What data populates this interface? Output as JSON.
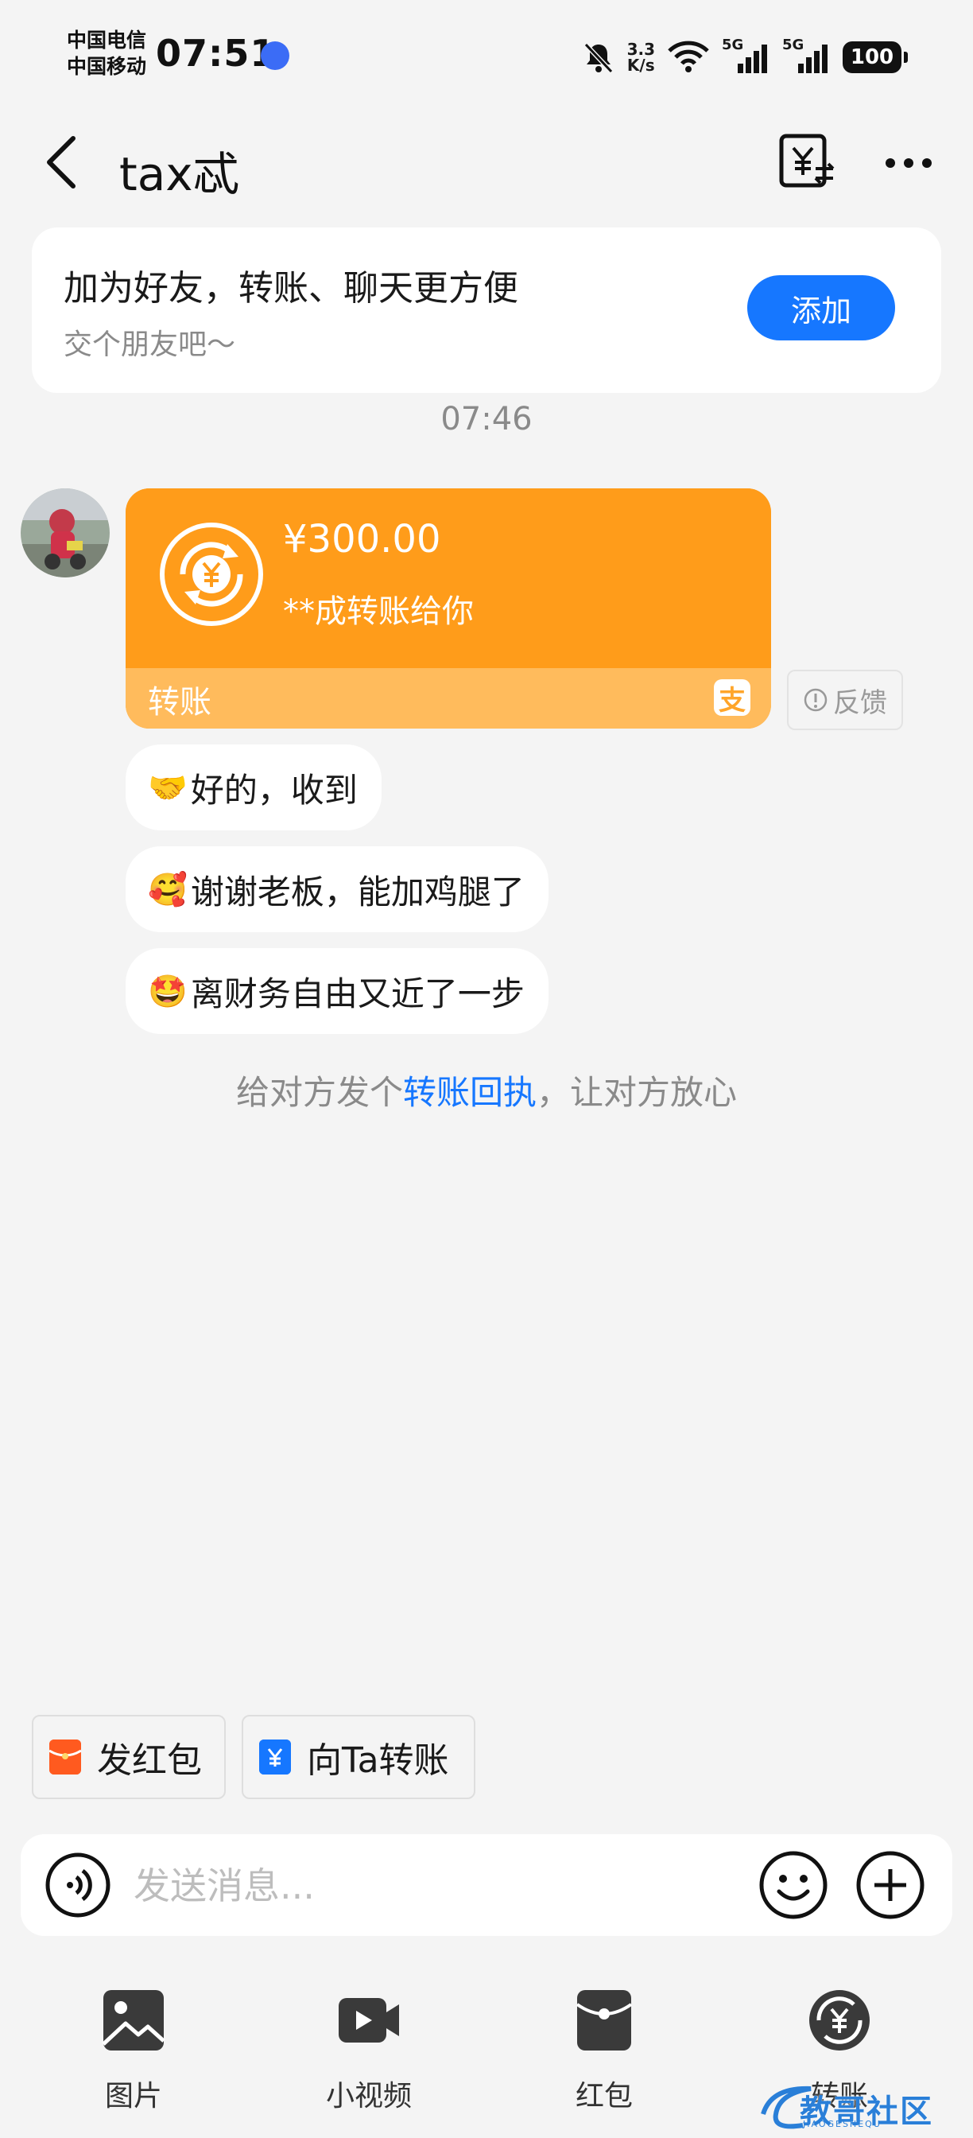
{
  "status_bar": {
    "carrier1": "中国电信",
    "carrier2": "中国移动",
    "time": "07:51",
    "net_speed_value": "3.3",
    "net_speed_unit": "K/s",
    "signal1": "5G",
    "signal2": "5G",
    "battery": "100"
  },
  "header": {
    "title": "tax忒"
  },
  "friend_card": {
    "title": "加为好友，转账、聊天更方便",
    "subtitle": "交个朋友吧～",
    "add_button": "添加"
  },
  "chat": {
    "timestamp": "07:46",
    "transfer": {
      "amount": "¥300.00",
      "description": "**成转账给你",
      "label": "转账",
      "logo_char": "支"
    },
    "feedback": "反馈",
    "messages": [
      {
        "emoji": "🤝",
        "text": "好的，收到"
      },
      {
        "emoji": "🥰",
        "text": "谢谢老板，能加鸡腿了"
      },
      {
        "emoji": "🤩",
        "text": "离财务自由又近了一步"
      }
    ],
    "receipt_hint": {
      "prefix": "给对方发个",
      "link": "转账回执",
      "suffix": "，让对方放心"
    }
  },
  "quick_actions": {
    "red_packet": "发红包",
    "transfer_to": "向Ta转账"
  },
  "input": {
    "placeholder": "发送消息..."
  },
  "tools": [
    {
      "label": "图片",
      "icon": "image-icon"
    },
    {
      "label": "小视频",
      "icon": "video-icon"
    },
    {
      "label": "红包",
      "icon": "red-packet-icon"
    },
    {
      "label": "转账",
      "icon": "transfer-icon"
    }
  ],
  "watermark": {
    "text": "教哥社区",
    "subtext": "JIAOGESHEQU"
  },
  "colors": {
    "accent": "#1677ff",
    "transfer_card": "#ff9c1a",
    "transfer_bar": "#ffbb5c",
    "red": "#ff5a1f"
  }
}
